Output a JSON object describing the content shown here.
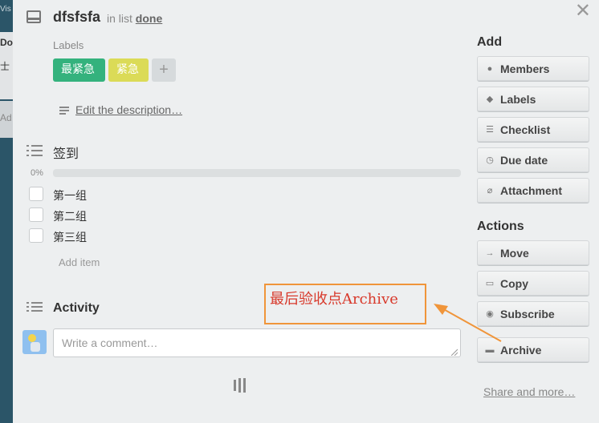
{
  "background": {
    "board_text": "Vis",
    "list_title": "Do",
    "card_text": "士",
    "card_text2": "Ad"
  },
  "card": {
    "title": "dfsfsfa",
    "in_list_prefix": "in list",
    "list_name": "done"
  },
  "labels": {
    "heading": "Labels",
    "items": [
      {
        "text": "最紧急",
        "color": "#34b27d"
      },
      {
        "text": "紧急",
        "color": "#dbdb57"
      }
    ],
    "add": "+"
  },
  "description": {
    "link": "Edit the description…"
  },
  "checklist": {
    "title": "签到",
    "progress_text": "0%",
    "progress": 0,
    "items": [
      {
        "text": "第一组",
        "checked": false
      },
      {
        "text": "第二组",
        "checked": false
      },
      {
        "text": "第三组",
        "checked": false
      }
    ],
    "add_item": "Add item"
  },
  "activity": {
    "title": "Activity",
    "comment_placeholder": "Write a comment…"
  },
  "sidebar": {
    "add_heading": "Add",
    "add_buttons": [
      {
        "label": "Members",
        "icon": "person-icon"
      },
      {
        "label": "Labels",
        "icon": "tag-icon"
      },
      {
        "label": "Checklist",
        "icon": "checklist-icon"
      },
      {
        "label": "Due date",
        "icon": "clock-icon"
      },
      {
        "label": "Attachment",
        "icon": "paperclip-icon"
      }
    ],
    "actions_heading": "Actions",
    "action_buttons": [
      {
        "label": "Move",
        "icon": "arrow-right-icon"
      },
      {
        "label": "Copy",
        "icon": "card-icon"
      },
      {
        "label": "Subscribe",
        "icon": "eye-icon"
      },
      {
        "label": "Archive",
        "icon": "archive-icon"
      }
    ],
    "share_link": "Share and more…"
  },
  "annotation": {
    "text": "最后验收点Archive",
    "color": "#d8392b",
    "border_color": "#f0953a"
  }
}
